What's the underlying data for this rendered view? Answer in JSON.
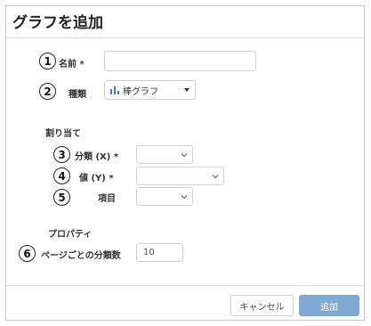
{
  "dialog": {
    "title": "グラフを追加",
    "fields": {
      "name": {
        "marker": "1",
        "label": "名前",
        "required_mark": "*",
        "value": ""
      },
      "type": {
        "marker": "2",
        "label": "種類",
        "selected": "棒グラフ",
        "icon": "bar-chart-icon"
      },
      "assign_section": "割り当て",
      "category": {
        "marker": "3",
        "label": "分類 (X)",
        "required_mark": "*",
        "value": ""
      },
      "value": {
        "marker": "4",
        "label": "値 (Y)",
        "required_mark": "*",
        "value": ""
      },
      "item": {
        "marker": "5",
        "label": "項目",
        "value": ""
      },
      "property_section": "プロパティ",
      "per_page": {
        "marker": "6",
        "label": "ページごとの分類数",
        "value": "10"
      }
    },
    "buttons": {
      "cancel": "キャンセル",
      "add": "追加"
    }
  },
  "colors": {
    "accent": "#7fa9d2",
    "chart_icon": "#3a7fc4"
  }
}
